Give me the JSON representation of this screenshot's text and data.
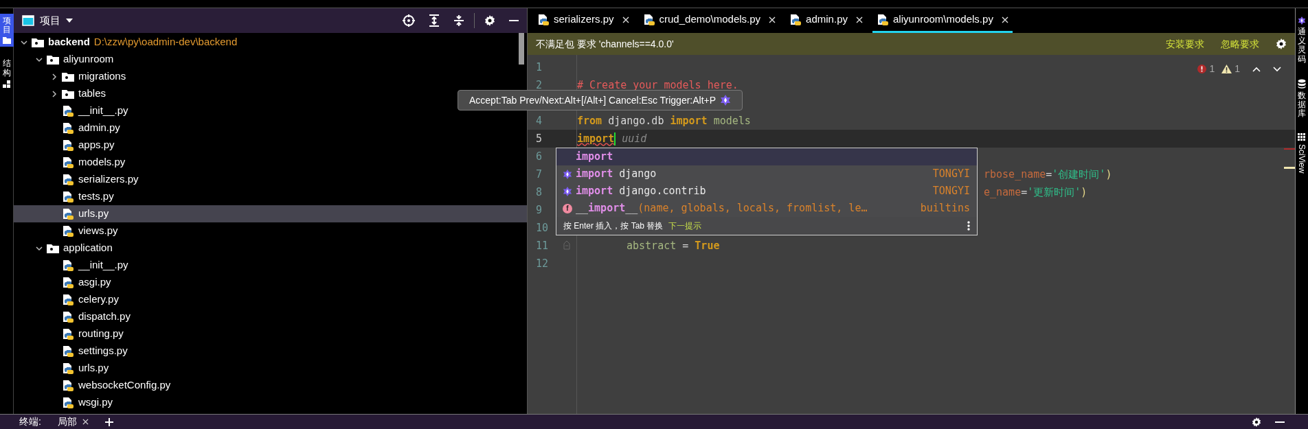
{
  "activity_bar": {
    "tabs": [
      {
        "label": "项目",
        "selected": true
      },
      {
        "label": "结构",
        "selected": false
      }
    ]
  },
  "project_panel": {
    "title": "项目",
    "tree": [
      {
        "name": "backend",
        "path": "D:\\zzw\\py\\oadmin-dev\\backend",
        "kind": "root",
        "expanded": true,
        "selected": false,
        "children": [
          {
            "name": "aliyunroom",
            "kind": "folder",
            "expanded": true,
            "selected": false,
            "children": [
              {
                "name": "migrations",
                "kind": "folder",
                "expanded": false,
                "selected": false
              },
              {
                "name": "tables",
                "kind": "folder",
                "expanded": false,
                "selected": false
              },
              {
                "name": "__init__.py",
                "kind": "file",
                "selected": false
              },
              {
                "name": "admin.py",
                "kind": "file",
                "selected": false
              },
              {
                "name": "apps.py",
                "kind": "file",
                "selected": false
              },
              {
                "name": "models.py",
                "kind": "file",
                "selected": false
              },
              {
                "name": "serializers.py",
                "kind": "file",
                "selected": false
              },
              {
                "name": "tests.py",
                "kind": "file",
                "selected": false
              },
              {
                "name": "urls.py",
                "kind": "file",
                "selected": true
              },
              {
                "name": "views.py",
                "kind": "file",
                "selected": false
              }
            ]
          },
          {
            "name": "application",
            "kind": "folder",
            "expanded": true,
            "selected": false,
            "children": [
              {
                "name": "__init__.py",
                "kind": "file",
                "selected": false
              },
              {
                "name": "asgi.py",
                "kind": "file",
                "selected": false
              },
              {
                "name": "celery.py",
                "kind": "file",
                "selected": false
              },
              {
                "name": "dispatch.py",
                "kind": "file",
                "selected": false
              },
              {
                "name": "routing.py",
                "kind": "file",
                "selected": false
              },
              {
                "name": "settings.py",
                "kind": "file",
                "selected": false
              },
              {
                "name": "urls.py",
                "kind": "file",
                "selected": false
              },
              {
                "name": "websocketConfig.py",
                "kind": "file",
                "selected": false
              },
              {
                "name": "wsgi.py",
                "kind": "file",
                "selected": false
              }
            ]
          }
        ]
      }
    ]
  },
  "editor_tabs": [
    {
      "label": "serializers.py",
      "selected": false
    },
    {
      "label": "crud_demo\\models.py",
      "selected": false
    },
    {
      "label": "admin.py",
      "selected": false
    },
    {
      "label": "aliyunroom\\models.py",
      "selected": true
    }
  ],
  "banner": {
    "message": "不满足包 要求 'channels==4.0.0'",
    "actions": [
      "安装要求",
      "忽略要求"
    ]
  },
  "inspections": {
    "errors": "1",
    "warnings": "1"
  },
  "code_lines": [
    {
      "number": "1",
      "kind": "normal"
    },
    {
      "number": "2",
      "kind": "normal",
      "tokens": [
        {
          "kind": "comment",
          "text": "# Create your models here."
        }
      ]
    },
    {
      "kind": "normal"
    },
    {
      "number": "4",
      "kind": "normal",
      "tokens": [
        {
          "kind": "keyword",
          "text": "from"
        },
        {
          "kind": "plain",
          "text": " django.db "
        },
        {
          "kind": "keyword",
          "text": "import"
        },
        {
          "kind": "name",
          "text": " models"
        }
      ]
    },
    {
      "number": "5",
      "kind": "current",
      "tokens": [
        {
          "kind": "error",
          "text": "import"
        },
        {
          "kind": "caret"
        },
        {
          "kind": "hint",
          "text": " uuid"
        }
      ]
    },
    {
      "number": "6",
      "kind": "normal"
    },
    {
      "number": "7",
      "kind": "covered",
      "tokens": [
        {
          "kind": "param",
          "text": "rbose_name"
        },
        {
          "kind": "plain",
          "text": "="
        },
        {
          "kind": "string",
          "text": "'创建时间'"
        },
        {
          "kind": "paren",
          "text": ")"
        }
      ]
    },
    {
      "number": "8",
      "kind": "covered",
      "tokens": [
        {
          "kind": "param",
          "text": "e_name"
        },
        {
          "kind": "plain",
          "text": "="
        },
        {
          "kind": "string",
          "text": "'更新时间'"
        },
        {
          "kind": "paren",
          "text": ")"
        }
      ]
    },
    {
      "number": "9",
      "kind": "normal"
    },
    {
      "number": "10",
      "kind": "normal"
    },
    {
      "number": "11",
      "kind": "folded",
      "tokens": [
        {
          "kind": "indent"
        },
        {
          "kind": "name",
          "text": "abstract"
        },
        {
          "kind": "plain",
          "text": " = "
        },
        {
          "kind": "keyword",
          "text": "True"
        }
      ]
    },
    {
      "number": "12",
      "kind": "normal"
    }
  ],
  "completion": {
    "items": [
      {
        "kind": "keyword",
        "match": "import",
        "selected": true
      },
      {
        "kind": "ai",
        "match": "import",
        "rest": " django",
        "source": "TONGYI",
        "selected": false
      },
      {
        "kind": "ai",
        "match": "import",
        "rest": " django.contrib",
        "source": "TONGYI",
        "selected": false
      },
      {
        "kind": "function",
        "icon": "f",
        "prefix": "__",
        "match": "import",
        "suffix": "__",
        "rest": "(name, globals, locals, fromlist, le…",
        "source": "builtins",
        "selected": false
      }
    ],
    "footer": "按 Enter 插入，按 Tab 替换",
    "next_hint": "下一提示"
  },
  "tooltip": {
    "text": "Accept:Tab Prev/Next:Alt+[/Alt+] Cancel:Esc Trigger:Alt+P"
  },
  "right_bar": {
    "tabs": [
      {
        "label": "通义灵码",
        "kind": "cjk"
      },
      {
        "label": "数据库",
        "kind": "cjk"
      },
      {
        "label": "SciView",
        "kind": "latin"
      }
    ]
  },
  "bottom_bar": {
    "label": "终端:",
    "tabs": [
      {
        "label": "局部",
        "selected": true
      }
    ]
  }
}
